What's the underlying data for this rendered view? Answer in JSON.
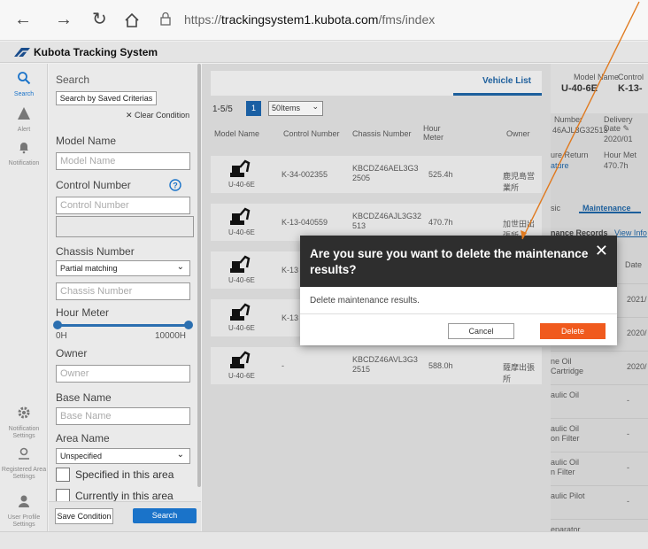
{
  "browser": {
    "url_prefix": "https://",
    "url_host": "trackingsystem1.kubota.com",
    "url_path": "/fms/index",
    "back_icon": "arrow-left-icon",
    "forward_icon": "arrow-right-icon",
    "reload_icon": "reload-icon",
    "home_icon": "home-icon"
  },
  "app": {
    "title": "Kubota Tracking System"
  },
  "rail": {
    "items": [
      {
        "label": "Search",
        "icon": "search-icon"
      },
      {
        "label": "Alert",
        "icon": "alert-icon"
      },
      {
        "label": "Notification",
        "icon": "bell-icon"
      },
      {
        "label": "Notification Settings",
        "icon": "gear-icon"
      },
      {
        "label": "Registered Area Settings",
        "icon": "location-pin-icon"
      },
      {
        "label": "User Profile Settings",
        "icon": "user-icon"
      }
    ]
  },
  "search": {
    "title": "Search",
    "saved_criteria_label": "Search by Saved Criterias",
    "clear_label": "✕ Clear Condition",
    "model_name_label": "Model Name",
    "model_name_placeholder": "Model Name",
    "control_number_label": "Control Number",
    "control_number_placeholder": "Control Number",
    "chassis_number_label": "Chassis Number",
    "chassis_match": "Partial matching",
    "chassis_number_placeholder": "Chassis Number",
    "hour_meter_label": "Hour Meter",
    "hour_min": "0H",
    "hour_max": "10000H",
    "owner_label": "Owner",
    "owner_placeholder": "Owner",
    "base_name_label": "Base Name",
    "base_name_placeholder": "Base Name",
    "area_name_label": "Area Name",
    "area_name_value": "Unspecified",
    "specified_area_label": "Specified in this area",
    "currently_area_label": "Currently in this area",
    "save_condition_label": "Save Condition",
    "search_button_label": "Search"
  },
  "vehicle_list": {
    "tab_label": "Vehicle List",
    "pager_text": "1-5/5",
    "current_page": "1",
    "items_per_page": "50Items",
    "columns": [
      "Model Name",
      "Control Number",
      "Chassis Number",
      "Hour Meter",
      "Owner"
    ],
    "rows": [
      {
        "model": "U-40-6E",
        "control": "K-34-002355",
        "chassis": "KBCDZ46AEL3G3 2505",
        "hour": "525.4h",
        "owner": "鹿児島営業所"
      },
      {
        "model": "U-40-6E",
        "control": "K-13-040559",
        "chassis": "KBCDZ46AJL3G32 513",
        "hour": "470.7h",
        "owner": "加世田出張所"
      },
      {
        "model": "U-40-6E",
        "control": "K-13",
        "chassis": "",
        "hour": "",
        "owner": ""
      },
      {
        "model": "U-40-6E",
        "control": "K-13",
        "chassis": "",
        "hour": "",
        "owner": ""
      },
      {
        "model": "U-40-6E",
        "control": "-",
        "chassis": "KBCDZ46AVL3G3 2515",
        "hour": "588.0h",
        "owner": "薩摩出張所"
      }
    ]
  },
  "detail": {
    "model_name_label": "Model Name",
    "model_name_value": "U-40-6E",
    "control_label": "Control",
    "control_value": "K-13-",
    "number_label": "Number",
    "number_value": "46AJL3G32513",
    "delivery_label": "Delivery",
    "date_label": "Date",
    "date_value": "2020/01",
    "return_label": "ure Return",
    "return_link": "ature",
    "hour_label": "Hour Met",
    "hour_value": "470.7h",
    "tab_basic": "sic",
    "tab_maintenance": "Maintenance",
    "records_label": "nance Records",
    "view_info": "View Info",
    "date_col": "Date",
    "rows": [
      {
        "name": "",
        "date": "2021/"
      },
      {
        "name": "",
        "date": "2020/"
      },
      {
        "name": "ne Oil\nCartridge",
        "date": "2020/"
      },
      {
        "name": "aulic Oil",
        "date": "-"
      },
      {
        "name": "aulic Oil\non Filter",
        "date": "-"
      },
      {
        "name": "aulic Oil\nn Filter",
        "date": "-"
      },
      {
        "name": "aulic Pilot",
        "date": "-"
      },
      {
        "name": "eparator\nent",
        "date": "2020/"
      }
    ]
  },
  "dialog": {
    "title": "Are you sure you want to delete the maintenance results?",
    "message": "Delete maintenance results.",
    "cancel_label": "Cancel",
    "delete_label": "Delete"
  },
  "colors": {
    "accent": "#1a73c9",
    "delete": "#f05a1e",
    "dialog_header": "#2e2e2e",
    "annotation_arrow": "#e07a1f"
  }
}
